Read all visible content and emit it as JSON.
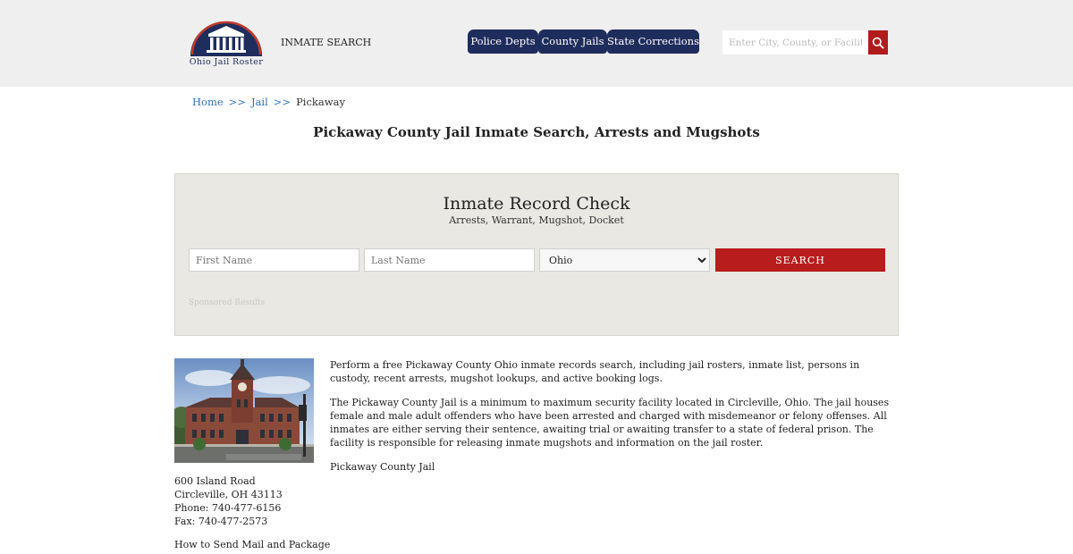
{
  "header": {
    "logo_text": "Ohio Jail Roster",
    "inmate_search_label": "INMATE SEARCH",
    "nav": [
      {
        "label": "Police Depts"
      },
      {
        "label": "County Jails"
      },
      {
        "label": "State Corrections"
      }
    ],
    "search_placeholder": "Enter City, County, or Facility",
    "colors": {
      "nav": "#1f2d5c",
      "accent": "#b01c1c",
      "header_bg": "#efefef"
    }
  },
  "breadcrumb": {
    "home": "Home",
    "jail": "Jail",
    "current": "Pickaway",
    "separator": ">>"
  },
  "page_title": "Pickaway County Jail Inmate Search, Arrests and Mugshots",
  "record_check": {
    "title": "Inmate Record Check",
    "subtitle": "Arrests, Warrant, Mugshot, Docket",
    "first_name_placeholder": "First Name",
    "last_name_placeholder": "Last Name",
    "state_selected": "Ohio",
    "search_label": "SEARCH",
    "sponsored": "Sponsored Results"
  },
  "facility": {
    "address_line1": "600 Island Road",
    "address_line2": "Circleville, OH 43113",
    "phone": "Phone: 740-477-6156",
    "fax": "Fax: 740-477-2573",
    "mail_link": "How to Send Mail and Package",
    "photo_icon": "courthouse-photo"
  },
  "content": {
    "paragraph1": "Perform a free Pickaway County Ohio inmate records search, including jail rosters, inmate list, persons in custody, recent arrests, mugshot lookups, and active booking logs.",
    "paragraph2": "The Pickaway County Jail is a minimum to maximum security facility located in Circleville, Ohio. The jail houses female and male adult offenders who have been arrested and charged with misdemeanor or felony offenses. All inmates are either serving their sentence, awaiting trial or awaiting transfer to a state of federal prison. The facility is responsible for releasing inmate mugshots and information on the jail roster.",
    "facility_name": "Pickaway County Jail"
  }
}
